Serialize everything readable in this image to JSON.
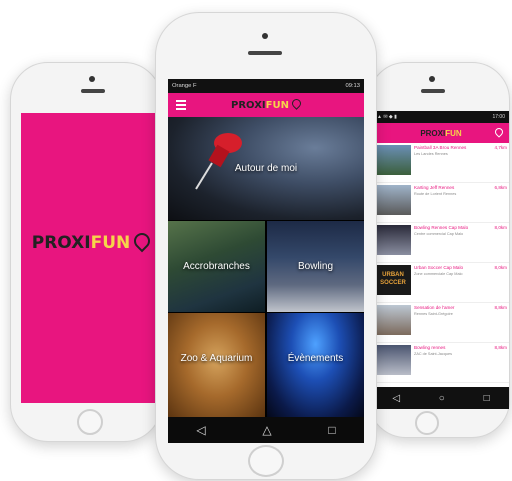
{
  "brand": {
    "logo_part1": "PROXI",
    "logo_part2": "FUN",
    "accent_color": "#e8157f",
    "logo_yellow": "#f6d44a"
  },
  "center": {
    "status_left": "Orange F",
    "status_right": "09:13",
    "header_title_a": "PROXI",
    "header_title_b": "FUN",
    "tiles": [
      {
        "label": "Autour de moi"
      },
      {
        "label": "Accrobranches"
      },
      {
        "label": "Bowling"
      },
      {
        "label": "Zoo & Aquarium"
      },
      {
        "label": "Évènements"
      }
    ],
    "nav": {
      "back": "◁",
      "home": "△",
      "recent": "□"
    }
  },
  "right": {
    "status_right": "17:00",
    "header_title_a": "PROXI",
    "header_title_b": "FUN",
    "items": [
      {
        "name": "Paintball 3A Brou Rennes",
        "sub": "Les Landes Rennes",
        "dist": "4,7km"
      },
      {
        "name": "Karting Jeff Rennes",
        "sub": "Route de Lorient Rennes",
        "dist": "6,8km"
      },
      {
        "name": "Bowling Rennes Cap Malo",
        "sub": "Centre commercial Cap Malo",
        "dist": "8,0km"
      },
      {
        "name": "Urban Soccer Cap Malo",
        "sub": "Zone commerciale Cap Malo",
        "dist": "8,0km"
      },
      {
        "name": "Sensation de l'amer",
        "sub": "Rennes Saint-Grégoire",
        "dist": "8,8km"
      },
      {
        "name": "Bowling rennes",
        "sub": "ZAC de Saint-Jacques",
        "dist": "8,8km"
      }
    ],
    "nav": {
      "back": "◁",
      "home": "○",
      "recent": "□"
    }
  }
}
